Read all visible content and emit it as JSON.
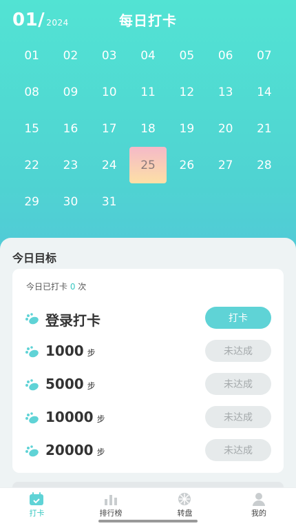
{
  "header": {
    "month": "01/",
    "year": "2024",
    "title": "每日打卡"
  },
  "calendar": {
    "days": [
      "01",
      "02",
      "03",
      "04",
      "05",
      "06",
      "07",
      "08",
      "09",
      "10",
      "11",
      "12",
      "13",
      "14",
      "15",
      "16",
      "17",
      "18",
      "19",
      "20",
      "21",
      "22",
      "23",
      "24",
      "25",
      "26",
      "27",
      "28",
      "29",
      "30",
      "31"
    ],
    "today": "25"
  },
  "panel": {
    "title": "今日目标",
    "count_prefix": "今日已打卡 ",
    "count_value": "0",
    "count_suffix": " 次",
    "goals": [
      {
        "label": "登录打卡",
        "unit": "",
        "button": "打卡",
        "state": "active"
      },
      {
        "label": "1000",
        "unit": "步",
        "button": "未达成",
        "state": "disabled"
      },
      {
        "label": "5000",
        "unit": "步",
        "button": "未达成",
        "state": "disabled"
      },
      {
        "label": "10000",
        "unit": "步",
        "button": "未达成",
        "state": "disabled"
      },
      {
        "label": "20000",
        "unit": "步",
        "button": "未达成",
        "state": "disabled"
      }
    ]
  },
  "tabs": [
    {
      "label": "打卡",
      "icon": "calendar-check-icon",
      "active": true
    },
    {
      "label": "排行榜",
      "icon": "bar-chart-icon",
      "active": false
    },
    {
      "label": "转盘",
      "icon": "wheel-icon",
      "active": false
    },
    {
      "label": "我的",
      "icon": "user-icon",
      "active": false
    }
  ],
  "colors": {
    "accent": "#5fd3d6",
    "today_top": "#f5b9c8",
    "today_bottom": "#fde0a6"
  }
}
